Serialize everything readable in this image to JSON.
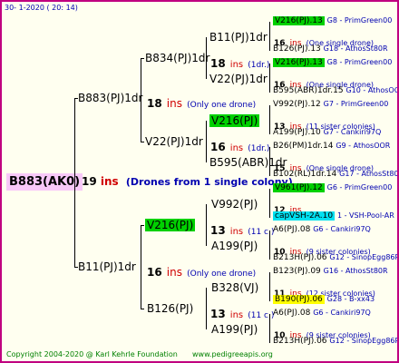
{
  "header": {
    "date": "30-   1-2020  ( 20:  14)"
  },
  "root": {
    "name": "B883(AK0)",
    "count": "19",
    "ins": "ins",
    "note": "(Drones from 1 single colony)"
  },
  "gen1": [
    {
      "name": "B883(PJ)1dr",
      "count": "18",
      "ins": "ins",
      "note": "(Only one drone)"
    },
    {
      "name": "B11(PJ)1dr",
      "count": "16",
      "ins": "ins",
      "note": "(Only one drone)"
    }
  ],
  "gen2": [
    {
      "name": "B834(PJ)1dr",
      "count": "18",
      "ins": "ins",
      "note": "(1dr.)"
    },
    {
      "name": "V22(PJ)1dr",
      "count": "16",
      "ins": "ins",
      "note": "(1dr.)"
    },
    {
      "name": "V216(PJ)",
      "count": "13",
      "ins": "ins",
      "note": "(11 c.)"
    },
    {
      "name": "B126(PJ)",
      "count": "13",
      "ins": "ins",
      "note": "(11 c.)"
    }
  ],
  "gen3": [
    {
      "name": "B11(PJ)1dr",
      "count": "16",
      "ins": "ins",
      "note": "(One single drone)"
    },
    {
      "name": "V22(PJ)1dr",
      "count": "16",
      "ins": "ins",
      "note": "(One single drone)"
    },
    {
      "name": "V216(PJ)",
      "count": "13",
      "ins": "ins",
      "note": "(11 sister colonies)"
    },
    {
      "name": "B595(ABR)1dr",
      "count": "15",
      "ins": "ins",
      "note": "(One single drone)"
    },
    {
      "name": "V992(PJ)",
      "count": "12",
      "ins": "ins",
      "note": ""
    },
    {
      "name": "A199(PJ)",
      "count": "10",
      "ins": "ins",
      "note": "(9 sister colonies)"
    },
    {
      "name": "B328(VJ)",
      "count": "11",
      "ins": "ins",
      "note": "(12 sister colonies)"
    },
    {
      "name": "A199(PJ)",
      "count": "10",
      "ins": "ins",
      "note": "(9 sister colonies)"
    }
  ],
  "gen4": [
    {
      "name": "V216(PJ).13",
      "right": "G8 - PrimGreen00"
    },
    {
      "name": "B126(PJ).13",
      "right": "G18 - AthosSt80R"
    },
    {
      "name": "V216(PJ).13",
      "right": "G8 - PrimGreen00"
    },
    {
      "name": "B595(ABR)1dr.15",
      "right": "G10 - AthosOO R"
    },
    {
      "name": "V992(PJ).12",
      "right": "G7 - PrimGreen00"
    },
    {
      "name": "A199(PJ).10",
      "right": "G7 - Cankiri97Q"
    },
    {
      "name": "B26(PM)1dr.14",
      "right": "G9 - AthosOOR"
    },
    {
      "name": "B102(RL)1dr.14",
      "right": "G17 - AthosSt80R"
    },
    {
      "name": "V961(PJ).12",
      "right": "G6 - PrimGreen00"
    },
    {
      "name": "capVSH-2A.10",
      "right": "1 - VSH-Pool-AR"
    },
    {
      "name": "A6(PJ).08",
      "right": "G6 - Cankiri97Q"
    },
    {
      "name": "B213H(PJ).06",
      "right": "G12 - SinopEgg86R"
    },
    {
      "name": "B123(PJ).09",
      "right": "G16 - AthosSt80R"
    },
    {
      "name": "B190(PJ).06",
      "right": "G28 - B-xx43"
    },
    {
      "name": "A6(PJ).08",
      "right": "G6 - Cankiri97Q"
    },
    {
      "name": "B213H(PJ).06",
      "right": "G12 - SinopEgg86R"
    }
  ],
  "footer": {
    "copyright": "Copyright 2004-2020 @ Karl Kehrle Foundation",
    "site": "www.pedigreeapis.org"
  }
}
